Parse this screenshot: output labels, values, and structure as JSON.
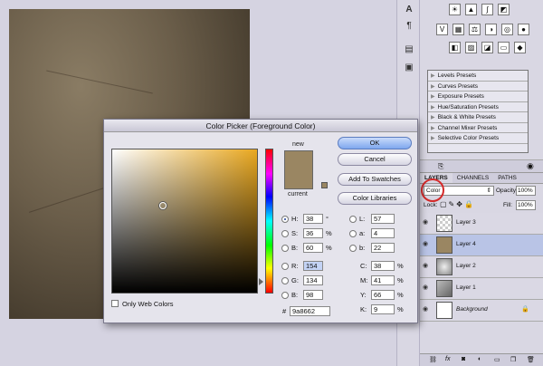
{
  "dialog": {
    "title": "Color Picker (Foreground Color)",
    "new_label": "new",
    "current_label": "current",
    "buttons": {
      "ok": "OK",
      "cancel": "Cancel",
      "add_swatches": "Add To Swatches",
      "color_libraries": "Color Libraries"
    },
    "only_web_colors": "Only Web Colors",
    "hsb": [
      {
        "label": "H:",
        "value": "38",
        "unit": "°",
        "selected": true
      },
      {
        "label": "S:",
        "value": "36",
        "unit": "%"
      },
      {
        "label": "B:",
        "value": "60",
        "unit": "%"
      }
    ],
    "rgb": [
      {
        "label": "R:",
        "value": "154"
      },
      {
        "label": "G:",
        "value": "134"
      },
      {
        "label": "B:",
        "value": "98"
      }
    ],
    "lab": [
      {
        "label": "L:",
        "value": "57"
      },
      {
        "label": "a:",
        "value": "4"
      },
      {
        "label": "b:",
        "value": "22"
      }
    ],
    "cmyk": [
      {
        "label": "C:",
        "value": "38",
        "unit": "%"
      },
      {
        "label": "M:",
        "value": "41",
        "unit": "%"
      },
      {
        "label": "Y:",
        "value": "66",
        "unit": "%"
      },
      {
        "label": "K:",
        "value": "9",
        "unit": "%"
      }
    ],
    "hex_label": "#",
    "hex_value": "9a8662",
    "color": "#9a8662"
  },
  "adjustments": {
    "presets": [
      "Levels Presets",
      "Curves Presets",
      "Exposure Presets",
      "Hue/Saturation Presets",
      "Black & White Presets",
      "Channel Mixer Presets",
      "Selective Color Presets"
    ]
  },
  "layers_panel": {
    "tabs": [
      "LAYERS",
      "CHANNELS",
      "PATHS"
    ],
    "blend_mode": "Color",
    "opacity_label": "Opacity:",
    "opacity_value": "100%",
    "lock_label": "Lock:",
    "fill_label": "Fill:",
    "fill_value": "100%",
    "layers": [
      "Layer 3",
      "Layer 4",
      "Layer 2",
      "Layer 1",
      "Background"
    ]
  }
}
